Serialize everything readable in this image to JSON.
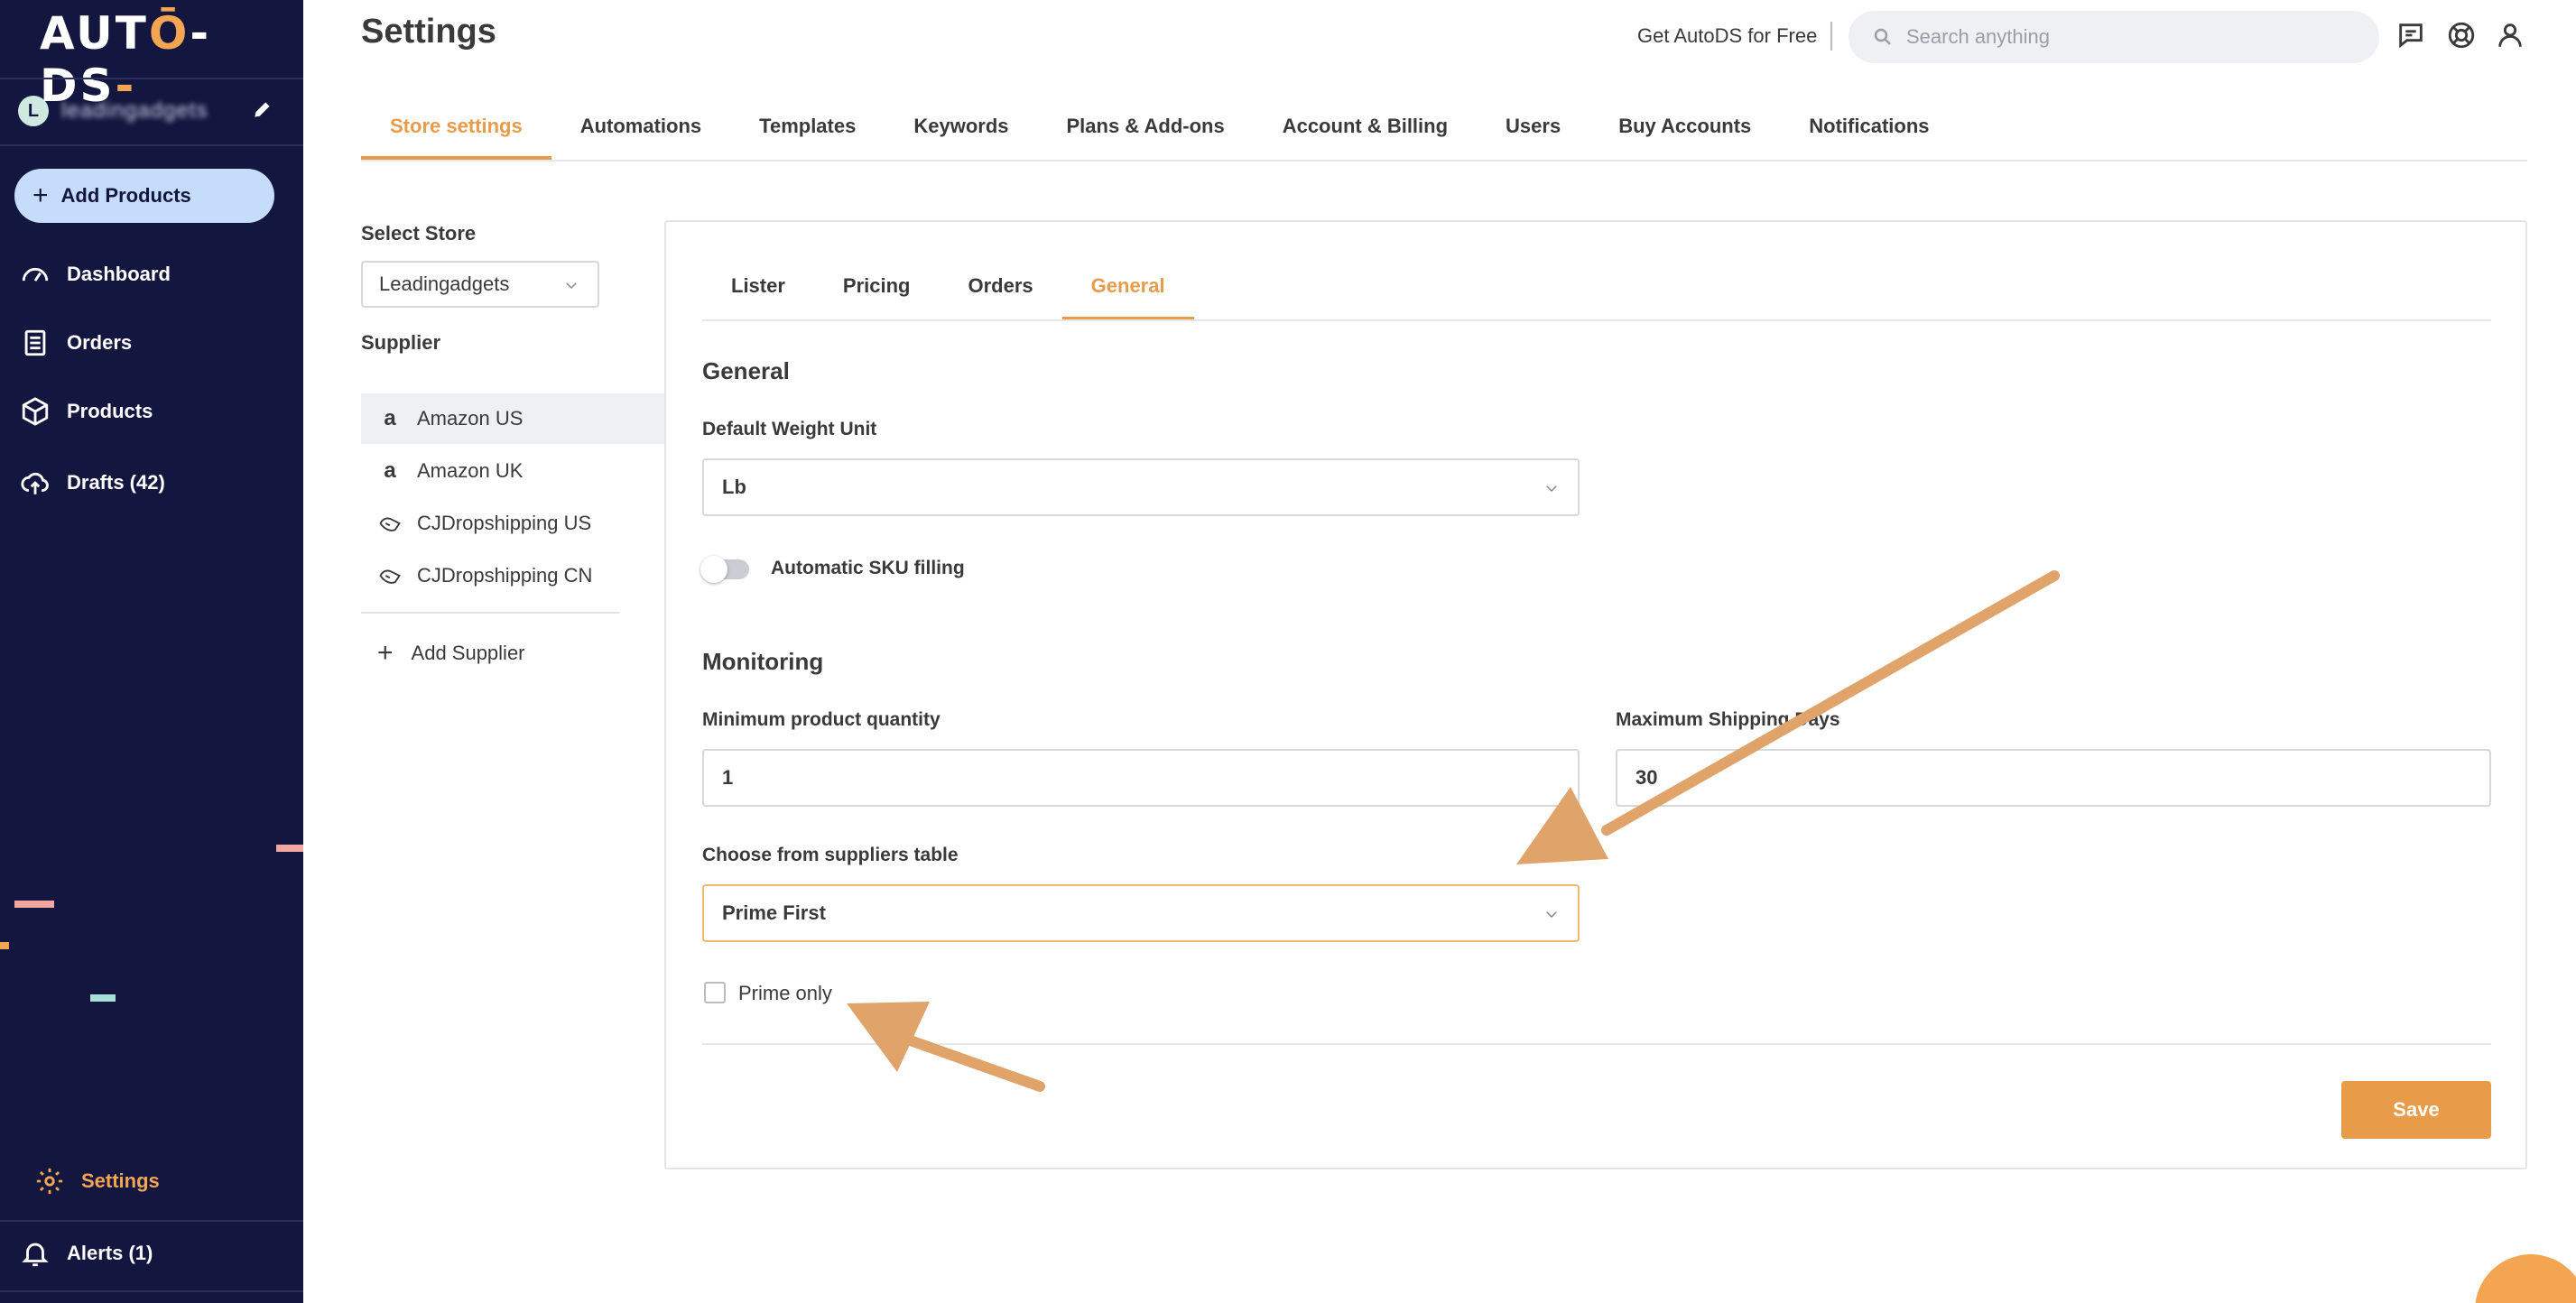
{
  "brand": {
    "logo": "AUTO-DS",
    "accent": "#e89c4a",
    "sidebar_bg": "#13163f"
  },
  "sidebar": {
    "user_initial": "L",
    "user_name": "leadingadgets",
    "add_products_label": "Add Products",
    "nav": [
      {
        "label": "Dashboard",
        "icon": "gauge-icon"
      },
      {
        "label": "Orders",
        "icon": "clipboard-icon"
      },
      {
        "label": "Products",
        "icon": "box-icon"
      },
      {
        "label": "Drafts (42)",
        "icon": "cloud-upload-icon"
      }
    ],
    "settings_label": "Settings",
    "alerts_label": "Alerts (1)"
  },
  "header": {
    "title": "Settings",
    "get_autods": "Get AutoDS for Free",
    "search_placeholder": "Search anything"
  },
  "tabs": [
    "Store settings",
    "Automations",
    "Templates",
    "Keywords",
    "Plans & Add-ons",
    "Account & Billing",
    "Users",
    "Buy Accounts",
    "Notifications"
  ],
  "store": {
    "select_label": "Select Store",
    "selected_store": "Leadingadgets",
    "supplier_label": "Supplier",
    "suppliers": [
      "Amazon US",
      "Amazon UK",
      "CJDropshipping US",
      "CJDropshipping CN"
    ],
    "add_supplier_label": "Add Supplier"
  },
  "subtabs": [
    "Lister",
    "Pricing",
    "Orders",
    "General"
  ],
  "general": {
    "section_title": "General",
    "weight_label": "Default Weight Unit",
    "weight_value": "Lb",
    "sku_label": "Automatic SKU filling",
    "sku_enabled": false
  },
  "monitoring": {
    "section_title": "Monitoring",
    "min_qty_label": "Minimum product quantity",
    "min_qty_value": "1",
    "max_days_label": "Maximum Shipping Days",
    "max_days_value": "30",
    "suppliers_table_label": "Choose from suppliers table",
    "suppliers_table_value": "Prime First",
    "prime_only_label": "Prime only",
    "prime_only_checked": false
  },
  "save_label": "Save"
}
